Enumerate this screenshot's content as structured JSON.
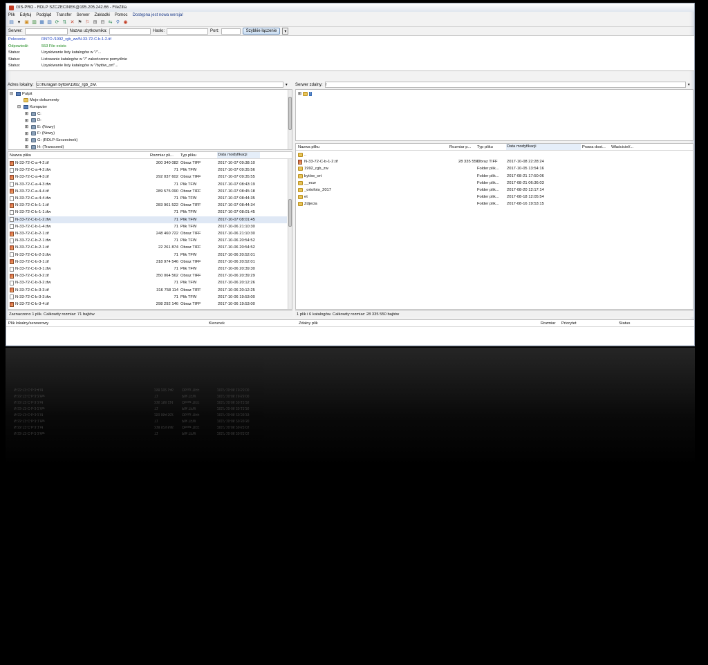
{
  "title": "GIS-PRO - RDLP SZCZECINEK@195.205.242.66 - FileZilla",
  "menu": [
    "Plik",
    "Edytuj",
    "Podgląd",
    "Transfer",
    "Serwer",
    "Zakładki",
    "Pomoc",
    "Dostępna jest nowa wersja!"
  ],
  "quickconnect": {
    "host_label": "Serwer:",
    "user_label": "Nazwa użytkownika:",
    "pass_label": "Hasło:",
    "port_label": "Port:",
    "button": "Szybkie łączenie"
  },
  "log": [
    {
      "label": "Polecenie:",
      "text": "RNTO /1992_rgb_zw/N-33-72-C-b-1-2.tif",
      "color": "#1a3fbf"
    },
    {
      "label": "Odpowiedź:",
      "text": "553 File exists",
      "color": "#1e8a1e"
    },
    {
      "label": "Status:",
      "text": "Uzyskiwanie listy katalogów w \"/\"...",
      "color": "#111111"
    },
    {
      "label": "Status:",
      "text": "Listowanie katalogów w \"/\" zakończone pomyślnie",
      "color": "#111111"
    },
    {
      "label": "Status:",
      "text": "Uzyskiwanie listy katalogów w \"/bytów_ort\"...",
      "color": "#111111"
    },
    {
      "label": "Status:",
      "text": "Listowanie katalogów w \"/bytów_ort\" zakończone pomyślnie",
      "color": "#111111"
    }
  ],
  "local": {
    "addr_label": "Adres lokalny:",
    "addr_value": "G:\\huragan bytów\\1992_rgb_zw\\",
    "tree": [
      {
        "label": "Pulpit",
        "indent": 0,
        "icon": "desktop",
        "exp": "⊟"
      },
      {
        "label": "Moje dokumenty",
        "indent": 1,
        "icon": "folder",
        "exp": ""
      },
      {
        "label": "Komputer",
        "indent": 1,
        "icon": "computer",
        "exp": "⊟"
      },
      {
        "label": "C:",
        "indent": 2,
        "icon": "drive",
        "exp": "⊞"
      },
      {
        "label": "D:",
        "indent": 2,
        "icon": "drive",
        "exp": "⊞"
      },
      {
        "label": "E: (Nowy)",
        "indent": 2,
        "icon": "drive",
        "exp": "⊞"
      },
      {
        "label": "F: (Nowy)",
        "indent": 2,
        "icon": "drive",
        "exp": "⊞"
      },
      {
        "label": "G: (RDLP-Szczecinek)",
        "indent": 2,
        "icon": "drive",
        "exp": "⊞"
      },
      {
        "label": "H: (Transcend)",
        "indent": 2,
        "icon": "drive",
        "exp": "⊞"
      }
    ],
    "columns": [
      "Nazwa pliku",
      "Rozmiar pli...",
      "Typ pliku",
      "Data modyfikacji"
    ],
    "files": [
      {
        "name": "N-33-72-C-a-4-2.tif",
        "size": "300 340 082",
        "type": "Obraz TIFF",
        "date": "2017-10-07 09:38:10"
      },
      {
        "name": "N-33-72-C-a-4-2.tfw",
        "size": "71",
        "type": "Plik TFW",
        "date": "2017-10-07 09:35:56"
      },
      {
        "name": "N-33-72-C-a-4-3.tif",
        "size": "292 037 602",
        "type": "Obraz TIFF",
        "date": "2017-10-07 09:35:55"
      },
      {
        "name": "N-33-72-C-a-4-3.tfw",
        "size": "71",
        "type": "Plik TFW",
        "date": "2017-10-07 08:43:19"
      },
      {
        "name": "N-33-72-C-a-4-4.tif",
        "size": "289 575 090",
        "type": "Obraz TIFF",
        "date": "2017-10-07 08:45:18"
      },
      {
        "name": "N-33-72-C-a-4-4.tfw",
        "size": "71",
        "type": "Plik TFW",
        "date": "2017-10-07 08:44:35"
      },
      {
        "name": "N-33-72-C-b-1-1.tif",
        "size": "283 961 522",
        "type": "Obraz TIFF",
        "date": "2017-10-07 08:44:34"
      },
      {
        "name": "N-33-72-C-b-1-1.tfw",
        "size": "71",
        "type": "Plik TFW",
        "date": "2017-10-07 08:01:45"
      },
      {
        "name": "N-33-72-C-b-1-2.tfw",
        "size": "71",
        "type": "Plik TFW",
        "date": "2017-10-07 08:01:45"
      },
      {
        "name": "N-33-72-C-b-1-4.tfw",
        "size": "71",
        "type": "Plik TFW",
        "date": "2017-10-06 21:10:30"
      },
      {
        "name": "N-33-72-C-b-2-1.tif",
        "size": "248 460 722",
        "type": "Obraz TIFF",
        "date": "2017-10-06 21:10:30"
      },
      {
        "name": "N-33-72-C-b-2-1.tfw",
        "size": "71",
        "type": "Plik TFW",
        "date": "2017-10-06 20:54:52"
      },
      {
        "name": "N-33-72-C-b-2-1.tif",
        "size": "22 261 874",
        "type": "Obraz TIFF",
        "date": "2017-10-06 20:54:52"
      },
      {
        "name": "N-33-72-C-b-2-3.tfw",
        "size": "71",
        "type": "Plik TFW",
        "date": "2017-10-06 20:52:01"
      },
      {
        "name": "N-33-72-C-b-3-1.tif",
        "size": "318 974 546",
        "type": "Obraz TIFF",
        "date": "2017-10-06 20:52:01"
      },
      {
        "name": "N-33-72-C-b-3-1.tfw",
        "size": "71",
        "type": "Plik TFW",
        "date": "2017-10-06 20:39:30"
      },
      {
        "name": "N-33-72-C-b-3-2.tif",
        "size": "350 064 562",
        "type": "Obraz TIFF",
        "date": "2017-10-06 20:39:29"
      },
      {
        "name": "N-33-72-C-b-3-2.tfw",
        "size": "71",
        "type": "Plik TFW",
        "date": "2017-10-06 20:12:26"
      },
      {
        "name": "N-33-72-C-b-3-3.tif",
        "size": "316 758 114",
        "type": "Obraz TIFF",
        "date": "2017-10-06 20:12:25"
      },
      {
        "name": "N-33-72-C-b-3-3.tfw",
        "size": "71",
        "type": "Plik TFW",
        "date": "2017-10-06 19:53:00"
      },
      {
        "name": "N-33-72-C-b-3-4.tif",
        "size": "298 292 146",
        "type": "Obraz TIFF",
        "date": "2017-10-06 19:53:00"
      }
    ],
    "status": "Zaznaczono 1 plik. Całkowity rozmiar: 71 bajtów"
  },
  "remote": {
    "addr_label": "Serwer zdalny:",
    "addr_value": "/",
    "columns": [
      "Nazwa pliku",
      "Rozmiar p...",
      "Typ pliku",
      "Data modyfikacji",
      "Prawa dost...",
      "Właściciel/..."
    ],
    "files": [
      {
        "name": "..",
        "size": "",
        "type": "",
        "date": ""
      },
      {
        "name": "N-33-72-C-b-1-2.tif",
        "size": "28 335 550",
        "type": "Obraz TIFF",
        "date": "2017-10-08 22:28:24"
      },
      {
        "name": "1992_rgb_zw",
        "size": "",
        "type": "Folder plik...",
        "date": "2017-10-05 13:54:16"
      },
      {
        "name": "bytów_ort",
        "size": "",
        "type": "Folder plik...",
        "date": "2017-08-21 17:50:06"
      },
      {
        "name": "__ecw",
        "size": "",
        "type": "Folder plik...",
        "date": "2017-08-21 06:36:03"
      },
      {
        "name": "_ortofoto_2017",
        "size": "",
        "type": "Folder plik...",
        "date": "2017-08-20 12:17:14"
      },
      {
        "name": "et",
        "size": "",
        "type": "Folder plik...",
        "date": "2017-08-18 12:05:54"
      },
      {
        "name": "Zdjecia",
        "size": "",
        "type": "Folder plik...",
        "date": "2017-08-16 19:53:15"
      }
    ],
    "status": "1 plik i 6 katalogów. Całkowity rozmiar: 28 335 550 bajtów"
  },
  "queue": {
    "columns": [
      "Plik lokalny/serwerowy",
      "Kierunek",
      "Zdalny plik",
      "Rozmiar",
      "Priorytet",
      "Status"
    ]
  }
}
